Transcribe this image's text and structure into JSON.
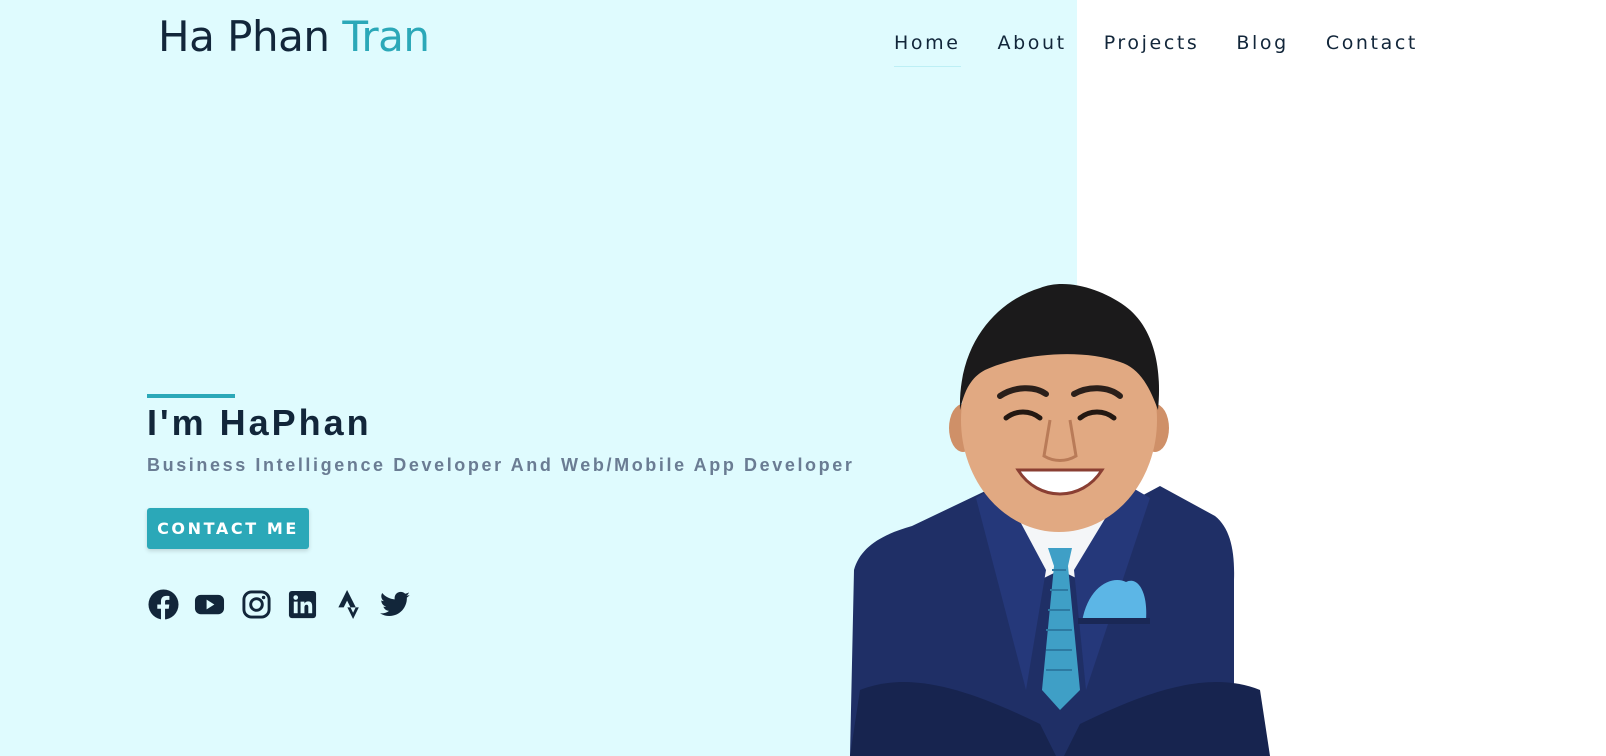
{
  "logo": {
    "first": "Ha Phan",
    "accent": "Tran"
  },
  "nav": {
    "home": "Home",
    "about": "About",
    "projects": "Projects",
    "blog": "Blog",
    "contact": "Contact"
  },
  "hero": {
    "title": "I'm HaPhan",
    "subtitle": "Business Intelligence Developer And Web/Mobile App Developer",
    "cta_label": "CONTACT ME"
  },
  "socials": [
    "facebook-icon",
    "youtube-icon",
    "instagram-icon",
    "linkedin-icon",
    "strava-icon",
    "twitter-icon"
  ],
  "colors": {
    "accent": "#2ba8b8",
    "hero_background": "#dffbfe",
    "text_dark": "#12263a",
    "text_muted": "#6a7c93",
    "suit_navy": "#1f2f66",
    "tie_blue": "#3f9fc6"
  }
}
